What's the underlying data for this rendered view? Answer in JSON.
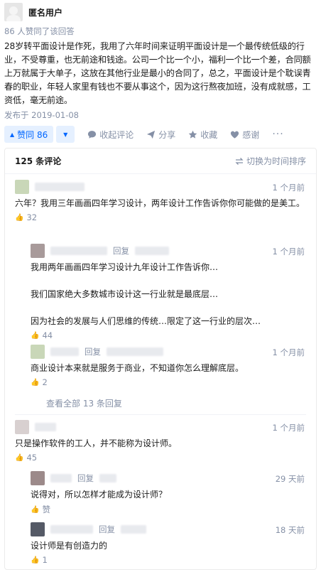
{
  "author": {
    "name": "匿名用户"
  },
  "answer": {
    "upvote_text": "86 人赞同了该回答",
    "text": "28岁转平面设计是作死，我用了六年时间来证明平面设计是一个最传统低级的行业，不受尊重，也无前途和钱途。公司一个比一个小，福利一个比一个差，合同额上万就属于大单子，这放在其他行业是最小的合同了，总之，平面设计是个耽误青春的职业，年轻人家里有钱也不要从事这个，因为这行熬夜加班，没有成就感，工资低，毫无前途。",
    "publish_date": "发布于 2019-01-08"
  },
  "actions": {
    "vote_up": "赞同 86",
    "vote_up_icon": "▲",
    "vote_down_icon": "▼",
    "comment_icon": "comment-icon",
    "comment": "收起评论",
    "share": "分享",
    "collect": "收藏",
    "thanks": "感谢",
    "more": "···"
  },
  "comments": {
    "count_label": "125 条评论",
    "sort_label": "切换为时间排序",
    "reply_word": "回复",
    "view_all": "查看全部 13 条回复",
    "items": [
      {
        "time": "1 个月前",
        "text": "六年？我用三年画画四年学习设计，两年设计工作告诉你你可能做的是美工。",
        "likes": "32",
        "avatar_color": "#c9d7b8"
      },
      {
        "time": "1 个月前",
        "text": "我用两年画画四年学习设计九年设计工作告诉你…\n\n我们国家绝大多数城市设计这一行业就是最底层…\n\n因为社会的发展与人们思维的传统…限定了这一行业的层次…",
        "likes": "44",
        "avatar_color": "#a89a9a"
      },
      {
        "time": "1 个月前",
        "text": "商业设计本来就是服务于商业，不知道你怎么理解底层。",
        "likes": "2",
        "avatar_color": "#c9d7b8"
      },
      {
        "time": "1 个月前",
        "text": "只是操作软件的工人，并不能称为设计师。",
        "likes": "45",
        "avatar_color": "#d8d0d0"
      },
      {
        "time": "29 天前",
        "text": "说得对，所以怎样才能成为设计师？",
        "likes": "赞",
        "avatar_color": "#9c8a8a"
      },
      {
        "time": "18 天前",
        "text": "设计师是有创造力的",
        "likes": "1",
        "avatar_color": "#555a66"
      }
    ]
  },
  "colors": {
    "accent": "#0066ff",
    "accent_bg": "#e5f0ff",
    "muted": "#8590a6",
    "text": "#1a1a1a"
  }
}
